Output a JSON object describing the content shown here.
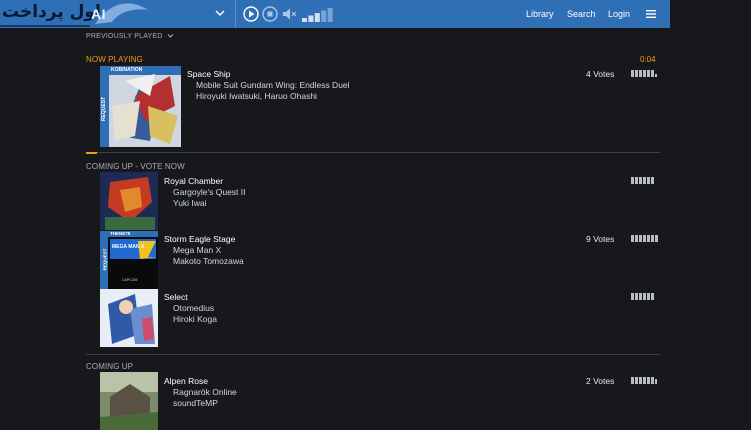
{
  "header": {
    "watermark_text": "اول پرداخت",
    "brand": "AI",
    "nav": {
      "library": "Library",
      "search": "Search",
      "login": "Login"
    },
    "volume_level": 0.6
  },
  "previously_played": {
    "label": "PREVIOUSLY PLAYED"
  },
  "now_playing": {
    "label": "NOW PLAYING",
    "time": "0:04",
    "progress": 0.02,
    "title": "Space Ship",
    "game": "Mobile Suit Gundam Wing: Endless Duel",
    "artist": "Hiroyuki Iwatsuki, Haruo Ohashi",
    "votes": "4 Votes",
    "cover_banner": "KOBINATION",
    "cover_side": "REQUEST"
  },
  "coming_up_vote": {
    "label": "COMING UP - VOTE NOW",
    "items": [
      {
        "title": "Royal Chamber",
        "game": "Gargoyle's Quest II",
        "artist": "Yuki Iwai",
        "votes": ""
      },
      {
        "title": "Storm Eagle Stage",
        "game": "Mega Man X",
        "artist": "Makoto Tomozawa",
        "votes": "9 Votes",
        "cover_banner": "THENE79",
        "cover_side": "REQUEST",
        "cover_logo": "MEGA MAN X",
        "cover_publisher": "CAPCOM"
      },
      {
        "title": "Select",
        "game": "Otomedius",
        "artist": "Hiroki Koga",
        "votes": ""
      }
    ]
  },
  "coming_up": {
    "label": "COMING UP",
    "items": [
      {
        "title": "Alpen Rose",
        "game": "Ragnarök Online",
        "artist": "soundTeMP",
        "votes": "2 Votes"
      }
    ]
  },
  "colors": {
    "accent": "#f29a1e",
    "topbar": "#2f6fb6",
    "background": "#16181b"
  }
}
